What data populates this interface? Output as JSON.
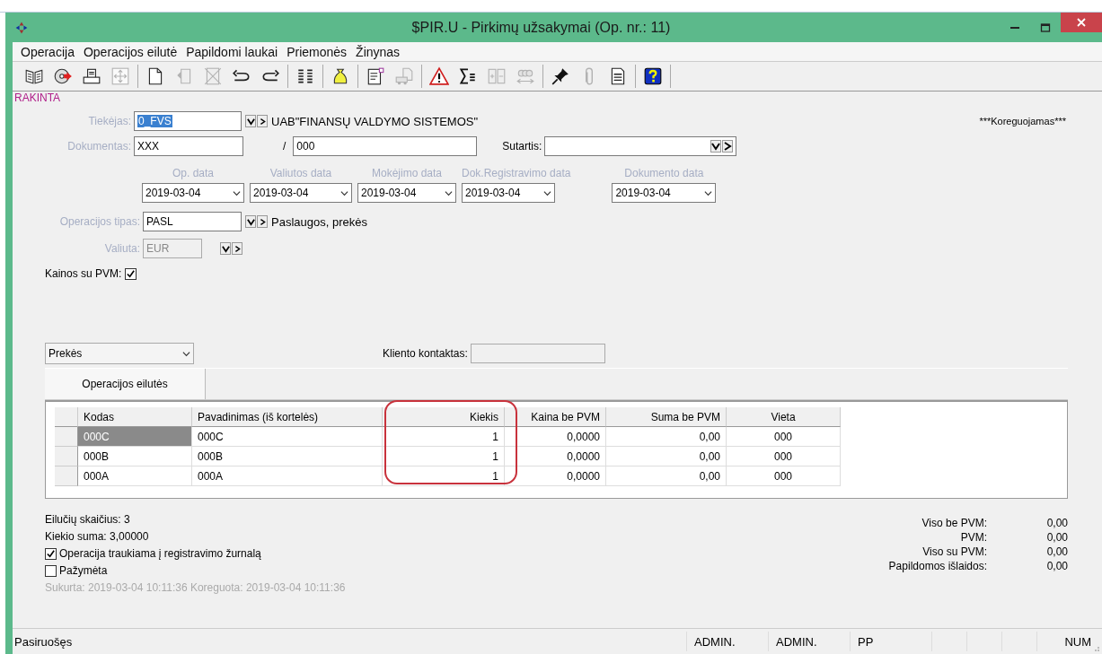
{
  "window": {
    "title": "$PIR.U - Pirkimų užsakymai (Op. nr.: 11)"
  },
  "menu": [
    "Operacija",
    "Operacijos eilutė",
    "Papildomi laukai",
    "Priemonės",
    "Žinynas"
  ],
  "toolbar": [
    [
      {
        "disabled": false
      },
      {
        "disabled": false
      },
      {
        "disabled": false
      },
      {
        "disabled": true
      }
    ],
    [
      {
        "disabled": false
      },
      {
        "disabled": true
      },
      {
        "disabled": true
      },
      {
        "disabled": false
      },
      {
        "disabled": false
      }
    ],
    [
      {
        "disabled": false
      }
    ],
    [
      {
        "disabled": false
      }
    ],
    [
      {
        "disabled": false
      },
      {
        "disabled": true
      }
    ],
    [
      {
        "disabled": false
      },
      {
        "disabled": false
      },
      {
        "disabled": true
      },
      {
        "disabled": true
      }
    ],
    [
      {
        "disabled": false
      },
      {
        "disabled": true
      },
      {
        "disabled": false
      }
    ],
    [
      {
        "disabled": false
      }
    ]
  ],
  "lock_label": "RAKINTA",
  "edit_state": "***Koreguojamas***",
  "supplier": {
    "label": "Tiekėjas:",
    "value": "0_FVS",
    "name": "UAB\"FINANSŲ VALDYMO SISTEMOS\""
  },
  "document": {
    "label": "Dokumentas:",
    "value": "XXX",
    "separator": "/",
    "number": "000"
  },
  "contract": {
    "label": "Sutartis:"
  },
  "dates": [
    {
      "label": "Op. data",
      "value": "2019-03-04"
    },
    {
      "label": "Valiutos data",
      "value": "2019-03-04"
    },
    {
      "label": "Mokėjimo data",
      "value": "2019-03-04"
    },
    {
      "label": "Dok.Registravimo data",
      "value": "2019-03-04"
    },
    {
      "label": "Dokumento data",
      "value": "2019-03-04"
    }
  ],
  "operation_type": {
    "label": "Operacijos tipas:",
    "value": "PASL",
    "description": "Paslaugos, prekės"
  },
  "currency": {
    "label": "Valiuta:",
    "value": "EUR",
    "disabled": true
  },
  "prices_with_vat": {
    "label": "Kainos su PVM:",
    "checked": true
  },
  "category": {
    "value": "Prekės"
  },
  "client_contact": {
    "label": "Kliento kontaktas:"
  },
  "tabs": [
    {
      "label": "Operacijos eilutės",
      "selected": true
    }
  ],
  "table": {
    "columns": [
      "Kodas",
      "Pavadinimas (iš kortelės)",
      "Kiekis",
      "Kaina be PVM",
      "Suma be PVM",
      "Vieta"
    ],
    "rows": [
      {
        "selected": true,
        "cells": [
          "000C",
          "000C",
          "1",
          "0,0000",
          "0,00",
          "000"
        ]
      },
      {
        "selected": false,
        "cells": [
          "000B",
          "000B",
          "1",
          "0,0000",
          "0,00",
          "000"
        ]
      },
      {
        "selected": false,
        "cells": [
          "000A",
          "000A",
          "1",
          "0,0000",
          "0,00",
          "000"
        ]
      }
    ]
  },
  "summary": {
    "row_count": "Eilučių skaičius: 3",
    "quantity_sum": "Kiekio suma: 3,00000"
  },
  "journal": {
    "label": "Operacija traukiama į registravimo žurnalą",
    "checked": true
  },
  "marked": {
    "label": "Pažymėta",
    "checked": false
  },
  "audit": "Sukurta: 2019-03-04 10:11:36 Koreguota: 2019-03-04 10:11:36",
  "totals": [
    {
      "label": "Viso be PVM:",
      "value": "0,00"
    },
    {
      "label": "PVM:",
      "value": "0,00"
    },
    {
      "label": "Viso su PVM:",
      "value": "0,00"
    },
    {
      "label": "Papildomos išlaidos:",
      "value": "0,00"
    }
  ],
  "status_bar": {
    "message": "Pasiruošęs",
    "panels": [
      "ADMIN.",
      "ADMIN.",
      "PP"
    ],
    "num": "NUM"
  }
}
